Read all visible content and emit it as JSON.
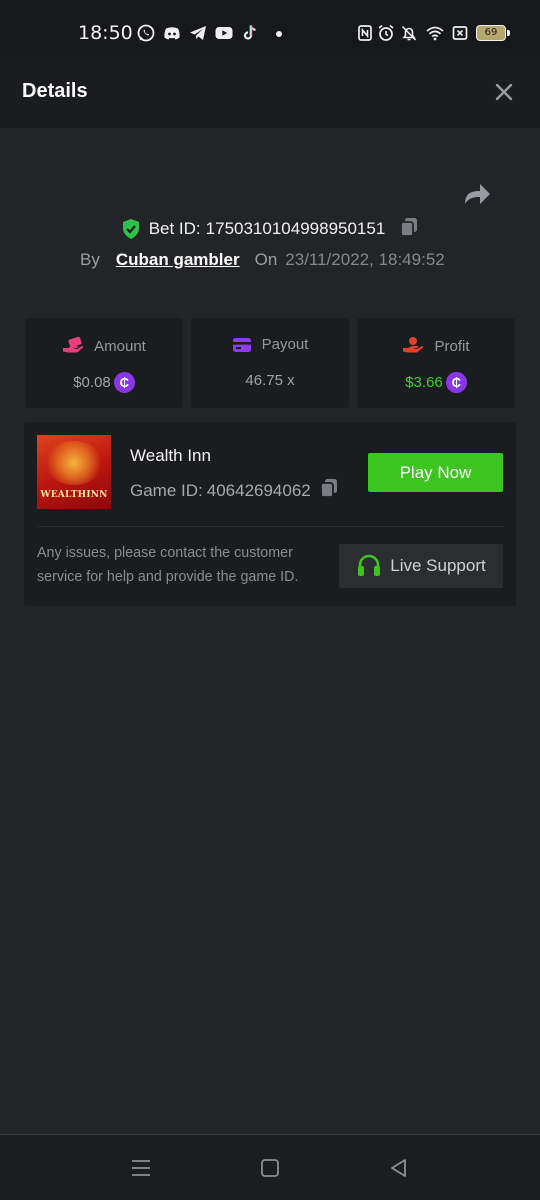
{
  "status_bar": {
    "time": "18:50",
    "notification_icons": [
      "whatsapp-icon",
      "discord-icon",
      "telegram-icon",
      "youtube-icon",
      "tiktok-icon",
      "dot-icon"
    ],
    "system_icons": [
      "nfc-icon",
      "alarm-icon",
      "mute-icon",
      "wifi-icon",
      "no-sim-icon"
    ],
    "battery": "69"
  },
  "header": {
    "title": "Details"
  },
  "bet": {
    "id_label": "Bet ID:",
    "id_value": "1750310104998950151",
    "by_label": "By",
    "user": "Cuban gambler",
    "on_label": "On",
    "date": "23/11/2022, 18:49:52"
  },
  "stats": [
    {
      "label": "Amount",
      "value": "$0.08",
      "icon": "hand-money-icon",
      "icon_color": "#e8407a"
    },
    {
      "label": "Payout",
      "value": "46.75 x",
      "icon": "card-icon",
      "icon_color": "#8e3cf0"
    },
    {
      "label": "Profit",
      "value": "$3.66",
      "icon": "hand-coins-icon",
      "icon_color": "#e2402a",
      "value_color": "#3fcf30"
    }
  ],
  "currency_symbol": "₵",
  "game": {
    "name": "Wealth Inn",
    "thumb_text": "WEALTHINN",
    "id_label": "Game ID:",
    "id_value": "40642694062",
    "play_label": "Play Now"
  },
  "support": {
    "text": "Any issues, please contact the customer service for help and provide the game ID.",
    "button_label": "Live Support"
  },
  "colors": {
    "accent_green": "#3dc51f",
    "coin_purple": "#8b36e6",
    "shield_green": "#2fc24a"
  }
}
